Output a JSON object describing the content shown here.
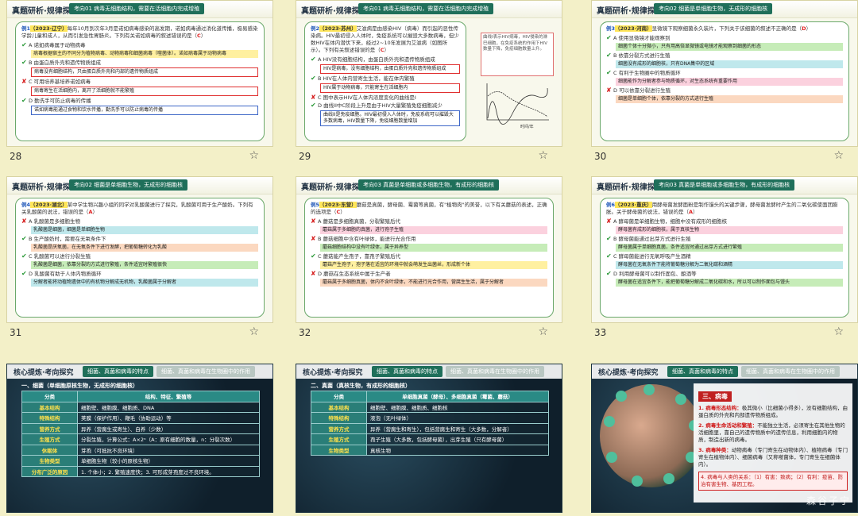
{
  "slides": [
    {
      "number": "28",
      "header_title": "真题研析·规律探寻",
      "header_tag": "考向01 病毒无细胞结构，需要在活细胞内完成增殖",
      "question": {
        "ex": "例1",
        "year": "（2023·辽宁）",
        "text": "每年10月到次年3月是诺如病毒感染的高发期，诺如病毒通过消化道传播，极易感染学龄儿童和成人，从而引发急性胃肠炎。下列有关诺如病毒的叙述错误的是（",
        "answer": "C",
        "tail": "）"
      },
      "options": [
        {
          "mark": "ok",
          "text": "A 诺如病毒属于动物病毒",
          "note": "病毒根据宿主的不同分为植物病毒、动物病毒和细菌病毒（噬菌体）。诺如病毒属于动物病毒",
          "color": "c-yellow"
        },
        {
          "mark": "ok",
          "text": "B 由蛋白质外壳和遗传物质组成",
          "note": "病毒没有细胞结构，只由蛋白质外壳和内部的遗传物质组成",
          "color": "c-outline"
        },
        {
          "mark": "no",
          "text": "C 可用培养基培养诺如病毒",
          "note": "病毒寄生在活细胞内，离开了活细胞就不能繁殖",
          "color": "c-outline"
        },
        {
          "mark": "ok",
          "text": "D 勤洗手可防止病毒的传播",
          "note": "诺如病毒能通过食物和饮水传播，勤洗手可以防止病毒的传播",
          "color": "c-blue"
        }
      ]
    },
    {
      "number": "29",
      "header_title": "真题研析·规律探寻",
      "header_tag": "考向01 病毒无细胞结构，需要在活细胞内完成增殖",
      "question": {
        "ex": "例2",
        "year": "（2023·苏州）",
        "text": "艾滋病是由感染HIV（病毒）而引起的恶性传染病。HIV最初侵入人体时，免疫系统可以摧毁大多数病毒，但少数HIV在体内潜伏下来，经过2~10年发展为艾滋病（如图所示）。下列有关叙述错误的是（",
        "answer": "C",
        "tail": "）"
      },
      "options": [
        {
          "mark": "ok",
          "text": "A HIV没有细胞结构，由蛋白质外壳和遗传物质组成",
          "note": "HIV是病毒，没有细胞结构，由蛋白质外壳和遗传物质组成",
          "color": "c-outline"
        },
        {
          "mark": "ok",
          "text": "B HIV在人体内营寄生生活，能在体内繁殖",
          "note": "HIV属于动物病毒，只能寄生在活细胞内",
          "color": "c-outline"
        },
        {
          "mark": "no",
          "text": "C 图中表示HIV在人体内浓度变化的曲线是I",
          "note": "",
          "color": ""
        },
        {
          "mark": "ok",
          "text": "D 曲线II中C阶段上升是由于HIV大量繁殖免疫细胞减少",
          "note": "曲线II是免疫细胞。HIV最初侵入人体时，免疫系统可以摧毁大多数病毒，HIV数量下降，免疫细胞数量增加",
          "color": "c-blue"
        }
      ],
      "side_note": "曲线I表示HIV病毒，HIV侵染的淋巴细胞，在免疫系统的作用下HIV数量下降，免疫细胞数量上升。",
      "chart_axis": "时间/年"
    },
    {
      "number": "30",
      "header_title": "真题研析·规律探寻",
      "header_tag": "考向02 细菌是单细胞生物，无成形的细胞核",
      "question": {
        "ex": "例3",
        "year": "（2023·河南）",
        "text": "显微镜下观察细菌永久装片，下列关于该细菌的叙述不正确的是（",
        "answer": "D",
        "tail": "）"
      },
      "options": [
        {
          "mark": "ok",
          "text": "A 使用显微镜才能观察到",
          "note": "细菌个体十分微小，只有用高倍显微镜或电镜才能观察到细菌的形态",
          "color": "c-green"
        },
        {
          "mark": "ok",
          "text": "B 依靠分裂方式进行生殖",
          "note": "细菌没有成形的细胞核，只有DNA集中的区域",
          "color": "c-cyan"
        },
        {
          "mark": "ok",
          "text": "C 有利于生物圈中的物质循环",
          "note": "细菌能作为分解者参与物质循环，对生态系统有重要作用",
          "color": "c-pink"
        },
        {
          "mark": "no",
          "text": "D 可以依靠分裂进行生殖",
          "note": "细菌是单细胞个体，依靠分裂的方式进行生殖",
          "color": "c-peach"
        }
      ]
    },
    {
      "number": "31",
      "header_title": "真题研析·规律探寻",
      "header_tag": "考向02 细菌是单细胞生物，无成形的细胞核",
      "question": {
        "ex": "例4",
        "year": "（2023·湖北）",
        "text": "某中学生物兴趣小组的同学对乳酸菌进行了探究，乳酸菌可用于生产酸奶。下列有关乳酸菌的说法，错误的是（",
        "answer": "A",
        "tail": "）"
      },
      "options": [
        {
          "mark": "no",
          "text": "A 乳酸菌是多细胞生物",
          "note": "乳酸菌是细菌，细菌是单细胞生物",
          "color": "c-cyan"
        },
        {
          "mark": "ok",
          "text": "B 生产酸奶时，需要在无氧条件下",
          "note": "乳酸菌是厌氧菌，在无氧条件下进行发酵，把葡萄糖转化为乳酸",
          "color": "c-peach"
        },
        {
          "mark": "ok",
          "text": "C 乳酸菌可以进行分裂生殖",
          "note": "乳酸菌是细菌，依靠分裂的方式进行繁殖，条件适宜时繁殖很快",
          "color": "c-green"
        },
        {
          "mark": "ok",
          "text": "D 乳酸菌有助于人体内物质循环",
          "note": "分解者能将动植物遗体中的有机物分解成无机物，乳酸菌属于分解者",
          "color": "c-cyan"
        }
      ]
    },
    {
      "number": "32",
      "header_title": "真题研析·规律探寻",
      "header_tag": "考向03 真菌是单细胞或多细胞生物，有成形的细胞核",
      "question": {
        "ex": "例5",
        "year": "（2023·东营）",
        "text": "蘑菇是真菌，酵母菌、霉菌等真菌，有\"植物肉\"的美誉，以下有关蘑菇的表述，正确的选项是（",
        "answer": "C",
        "tail": "）"
      },
      "options": [
        {
          "mark": "no",
          "text": "A 蘑菇是多细胞真菌，分裂繁殖后代",
          "note": "蘑菇属于多细胞的真菌，进行孢子生殖",
          "color": "c-pink"
        },
        {
          "mark": "no",
          "text": "B 蘑菇细胞中含有叶绿体，能进行光合作用",
          "note": "蘑菇细胞结构中没有叶绿体，属于异养型",
          "color": "c-green"
        },
        {
          "mark": "ok",
          "text": "C 蘑菇能产生孢子，靠孢子繁殖后代",
          "note": "蘑菇产生孢子，孢子落在适宜的环境中就会萌发生出菌丝，形成新个体",
          "color": "c-yellow"
        },
        {
          "mark": "no",
          "text": "D 蘑菇在生态系统中属于生产者",
          "note": "蘑菇属于多细胞真菌，体内不含叶绿体，不能进行光合作用，营腐生生活，属于分解者",
          "color": "c-peach"
        }
      ]
    },
    {
      "number": "33",
      "header_title": "真题研析·规律探寻",
      "header_tag": "考向03 真菌是单细胞或多细胞生物，有成形的细胞核",
      "question": {
        "ex": "例6",
        "year": "（2023·重庆）",
        "text": "用酵母菌发酵面粉是制作馒头的关键步骤，酵母菌发酵时产生的二氧化碳使面团膨胀。关于酵母菌的说法，错误的是（",
        "answer": "A",
        "tail": "）"
      },
      "options": [
        {
          "mark": "no",
          "text": "A 酵母菌是单细胞生物，细胞中没有成形的细胞核",
          "note": "酵母菌有成形的细胞核，属于真核生物",
          "color": "c-pink"
        },
        {
          "mark": "ok",
          "text": "B 酵母菌能通过出芽方式进行生殖",
          "note": "酵母菌属于单细胞真菌，条件适宜时通过出芽方式进行繁殖",
          "color": "c-green"
        },
        {
          "mark": "ok",
          "text": "C 酵母菌能进行无氧呼吸产生酒精",
          "note": "酵母菌在无氧条件下能将葡萄糖分解为二氧化碳和酒精",
          "color": "c-cyan"
        },
        {
          "mark": "ok",
          "text": "D 利用酵母菌可以制作面包、酿酒等",
          "note": "酵母菌在适宜条件下，能把葡萄糖分解成二氧化碳和水，所以可以制作面包与馒头",
          "color": "c-green"
        }
      ]
    }
  ],
  "dark_slides": [
    {
      "number": "34",
      "header_title": "核心提炼·考向探究",
      "tabs": [
        "细菌、真菌和病毒的特点",
        "细菌、真菌和病毒在生物圈中的作用"
      ],
      "subtitle": "一、细菌（单细胞原核生物，无成形的细胞核）",
      "table_head": [
        "分类",
        "结构、特征、繁殖等"
      ],
      "rows": [
        [
          "基本结构",
          "细胞壁、细胞膜、细胞质、DNA"
        ],
        [
          "特殊结构",
          "荚膜（保护作用）、鞭毛（协助运动）等"
        ],
        [
          "营养方式",
          "异养（营腐生或寄生）、自养（少数）"
        ],
        [
          "生殖方式",
          "分裂生殖，计算公式：A×2ⁿ（A：原有细胞的数量，n：分裂次数）"
        ],
        [
          "休眠体",
          "芽孢（可抵抗不良环境）"
        ],
        [
          "生物类型",
          "单细胞生物（较小的原核生物）"
        ],
        [
          "分布广泛的原因",
          "1. 个体小；2. 繁殖速度快；3. 可形成芽孢度过不良环境。"
        ]
      ]
    },
    {
      "number": "35",
      "header_title": "核心提炼·考向探究",
      "tabs": [
        "细菌、真菌和病毒的特点",
        "细菌、真菌和病毒在生物圈中的作用"
      ],
      "subtitle": "二、真菌（真核生物，有成形的细胞核）",
      "table_head": [
        "分类",
        "单细胞真菌（酵母）、多细胞真菌（霉菌、蘑菇）"
      ],
      "rows": [
        [
          "基本结构",
          "细胞壁、细胞膜、细胞质、细胞核"
        ],
        [
          "特殊结构",
          "液泡（无叶绿体）"
        ],
        [
          "营养方式",
          "异养（营腐生和寄生），包括营腐生和寄生（大多数，分解者）"
        ],
        [
          "生殖方式",
          "孢子生殖（大多数，包括酵母菌），出芽生殖（只有酵母菌）"
        ],
        [
          "生物类型",
          "真核生物"
        ]
      ]
    },
    {
      "number": "36",
      "header_title": "核心提炼·考向探究",
      "tabs": [
        "细菌、真菌和病毒的特点",
        "细菌、真菌和病毒在生物圈中的作用"
      ],
      "section": "三、病毒",
      "points": [
        {
          "label": "1. 病毒形态结构：",
          "text": "极其微小（比细菌小得多），没有细胞结构，由蛋白质的外壳和内部遗传物质组成。"
        },
        {
          "label": "2. 病毒生命活动和繁殖：",
          "text": "不能独立生活，必须寄生在其他生物的活细胞里，靠自己的遗传物质中的遗传信息，利用细胞内的物质，制造出新的病毒。"
        },
        {
          "label": "3. 病毒种类：",
          "text": "动物病毒（专门寄生在动物体内）、植物病毒（专门寄生在植物体内）、细菌病毒（又称噬菌体，专门寄生在细菌体内）。"
        }
      ],
      "last_point": "4. 病毒与人类的关系：（1）有害：致病；（2）有利：疫苗、防治有害生物、基因工程。",
      "watermark": "森谷子宁"
    }
  ]
}
